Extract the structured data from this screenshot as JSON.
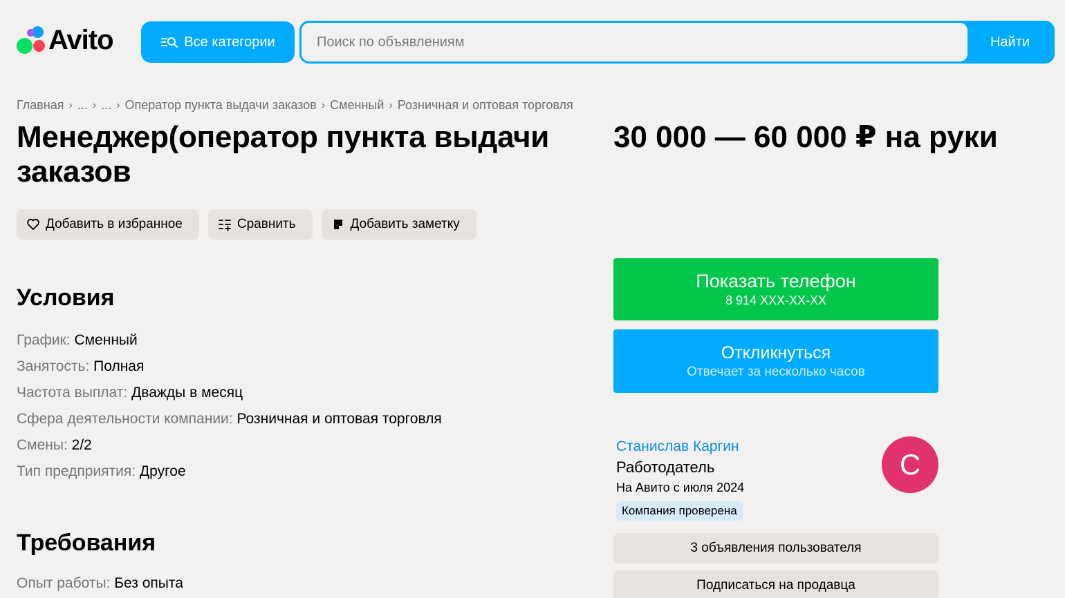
{
  "header": {
    "logo_text": "Avito",
    "categories_label": "Все категории",
    "search_placeholder": "Поиск по объявлениям",
    "search_button": "Найти"
  },
  "breadcrumbs": [
    "Главная",
    "...",
    "...",
    "Оператор пункта выдачи заказов",
    "Сменный",
    "Розничная и оптовая торговля"
  ],
  "listing": {
    "title": "Менеджер(оператор пункта выдачи заказов",
    "price": "30 000 — 60 000 ₽ на руки"
  },
  "actions": {
    "favorite": "Добавить в избранное",
    "compare": "Сравнить",
    "note": "Добавить заметку"
  },
  "conditions": {
    "heading": "Условия",
    "items": [
      {
        "key": "График:",
        "value": "Сменный"
      },
      {
        "key": "Занятость:",
        "value": "Полная"
      },
      {
        "key": "Частота выплат:",
        "value": "Дважды в месяц"
      },
      {
        "key": "Сфера деятельности компании:",
        "value": "Розничная и оптовая торговля"
      },
      {
        "key": "Смены:",
        "value": "2/2"
      },
      {
        "key": "Тип предприятия:",
        "value": "Другое"
      }
    ]
  },
  "requirements": {
    "heading": "Требования",
    "items": [
      {
        "key": "Опыт работы:",
        "value": "Без опыта"
      }
    ]
  },
  "contact": {
    "phone_label": "Показать телефон",
    "phone_masked": "8 914 XXX-XX-XX",
    "reply_label": "Откликнуться",
    "reply_sub": "Отвечает за несколько часов"
  },
  "seller": {
    "name": "Станислав Каргин",
    "role": "Работодатель",
    "since": "На Авито с июля 2024",
    "badge": "Компания проверена",
    "avatar_letter": "С",
    "ads_button": "3 объявления пользователя",
    "subscribe_button": "Подписаться на продавца"
  },
  "colors": {
    "accent_blue": "#00aaff",
    "green": "#02c74a",
    "avatar": "#e0336c",
    "background": "#f2f1f0"
  }
}
